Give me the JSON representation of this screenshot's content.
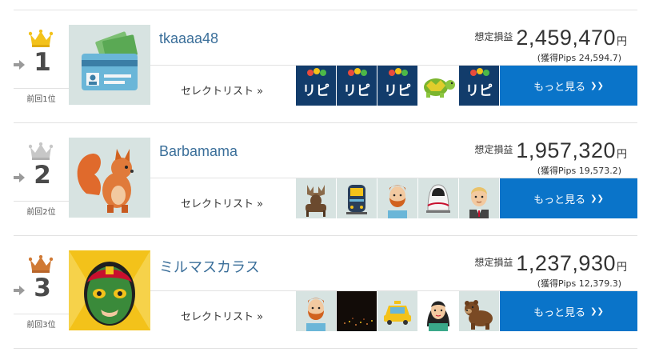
{
  "colors": {
    "accent": "#0a74c9",
    "username": "#3b6f9a",
    "gold": "#f3c21a",
    "silver": "#c7c7c7",
    "bronze": "#d07a35",
    "ripi": "#123c6b"
  },
  "rows": [
    {
      "rank": "1",
      "prev_rank_label": "前回1位",
      "crown": "gold-crown-icon",
      "username": "tkaaaa48",
      "profit_label": "想定損益",
      "profit_value": "2,459,470",
      "profit_unit": "円",
      "pips": "(獲得Pips 24,594.7)",
      "select_label": "セレクトリスト »",
      "more_label": "もっと見る",
      "avatar_icon": "id-card-money-icon",
      "thumbs": [
        "ripi-logo-icon",
        "ripi-logo-icon",
        "ripi-logo-icon",
        "turtle-icon",
        "ripi-logo-icon"
      ],
      "ripi_text": "リピ"
    },
    {
      "rank": "2",
      "prev_rank_label": "前回2位",
      "crown": "silver-crown-icon",
      "username": "Barbamama",
      "profit_label": "想定損益",
      "profit_value": "1,957,320",
      "profit_unit": "円",
      "pips": "(獲得Pips 19,573.2)",
      "select_label": "セレクトリスト »",
      "more_label": "もっと見る",
      "avatar_icon": "squirrel-icon",
      "thumbs": [
        "moose-icon",
        "train-icon",
        "red-bearded-man-icon",
        "bullet-train-icon",
        "blond-man-icon"
      ]
    },
    {
      "rank": "3",
      "prev_rank_label": "前回3位",
      "crown": "bronze-crown-icon",
      "username": "ミルマスカラス",
      "profit_label": "想定損益",
      "profit_value": "1,237,930",
      "profit_unit": "円",
      "pips": "(獲得Pips 12,379.3)",
      "select_label": "セレクトリスト »",
      "more_label": "もっと見る",
      "avatar_icon": "luchador-mask-icon",
      "thumbs": [
        "red-bearded-man-icon",
        "dark-city-photo-icon",
        "taxi-icon",
        "black-haired-woman-icon",
        "bear-icon"
      ]
    }
  ]
}
